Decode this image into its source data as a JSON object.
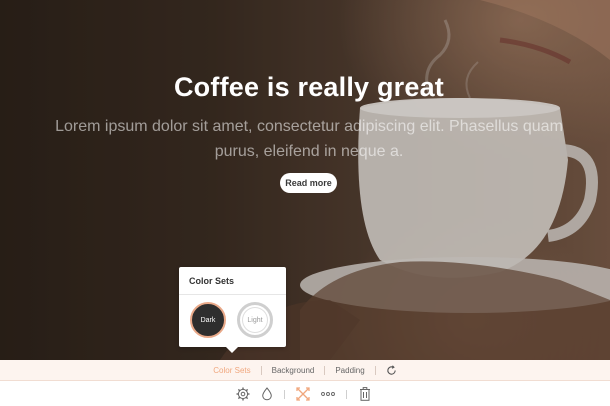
{
  "hero": {
    "headline": "Coffee is really great",
    "subtext": "Lorem ipsum dolor sit amet, consectetur adipiscing elit. Phasellus quam purus, eleifend in neque a.",
    "button_label": "Read more"
  },
  "popover": {
    "title": "Color Sets",
    "options": [
      {
        "label": "Dark",
        "selected": true
      },
      {
        "label": "Light",
        "selected": false
      }
    ]
  },
  "tabs": {
    "items": [
      {
        "label": "Color Sets",
        "active": true
      },
      {
        "label": "Background",
        "active": false
      },
      {
        "label": "Padding",
        "active": false
      }
    ],
    "reset_icon": "refresh-icon"
  },
  "toolbar": {
    "icons": [
      "gear-icon",
      "droplet-icon",
      "resize-icon",
      "more-icon",
      "trash-icon"
    ],
    "active_icon": "resize-icon"
  },
  "colors": {
    "accent": "#f0a77e",
    "tab_bg": "#fdf4ef",
    "dark_swatch": "#2e2e2e"
  }
}
